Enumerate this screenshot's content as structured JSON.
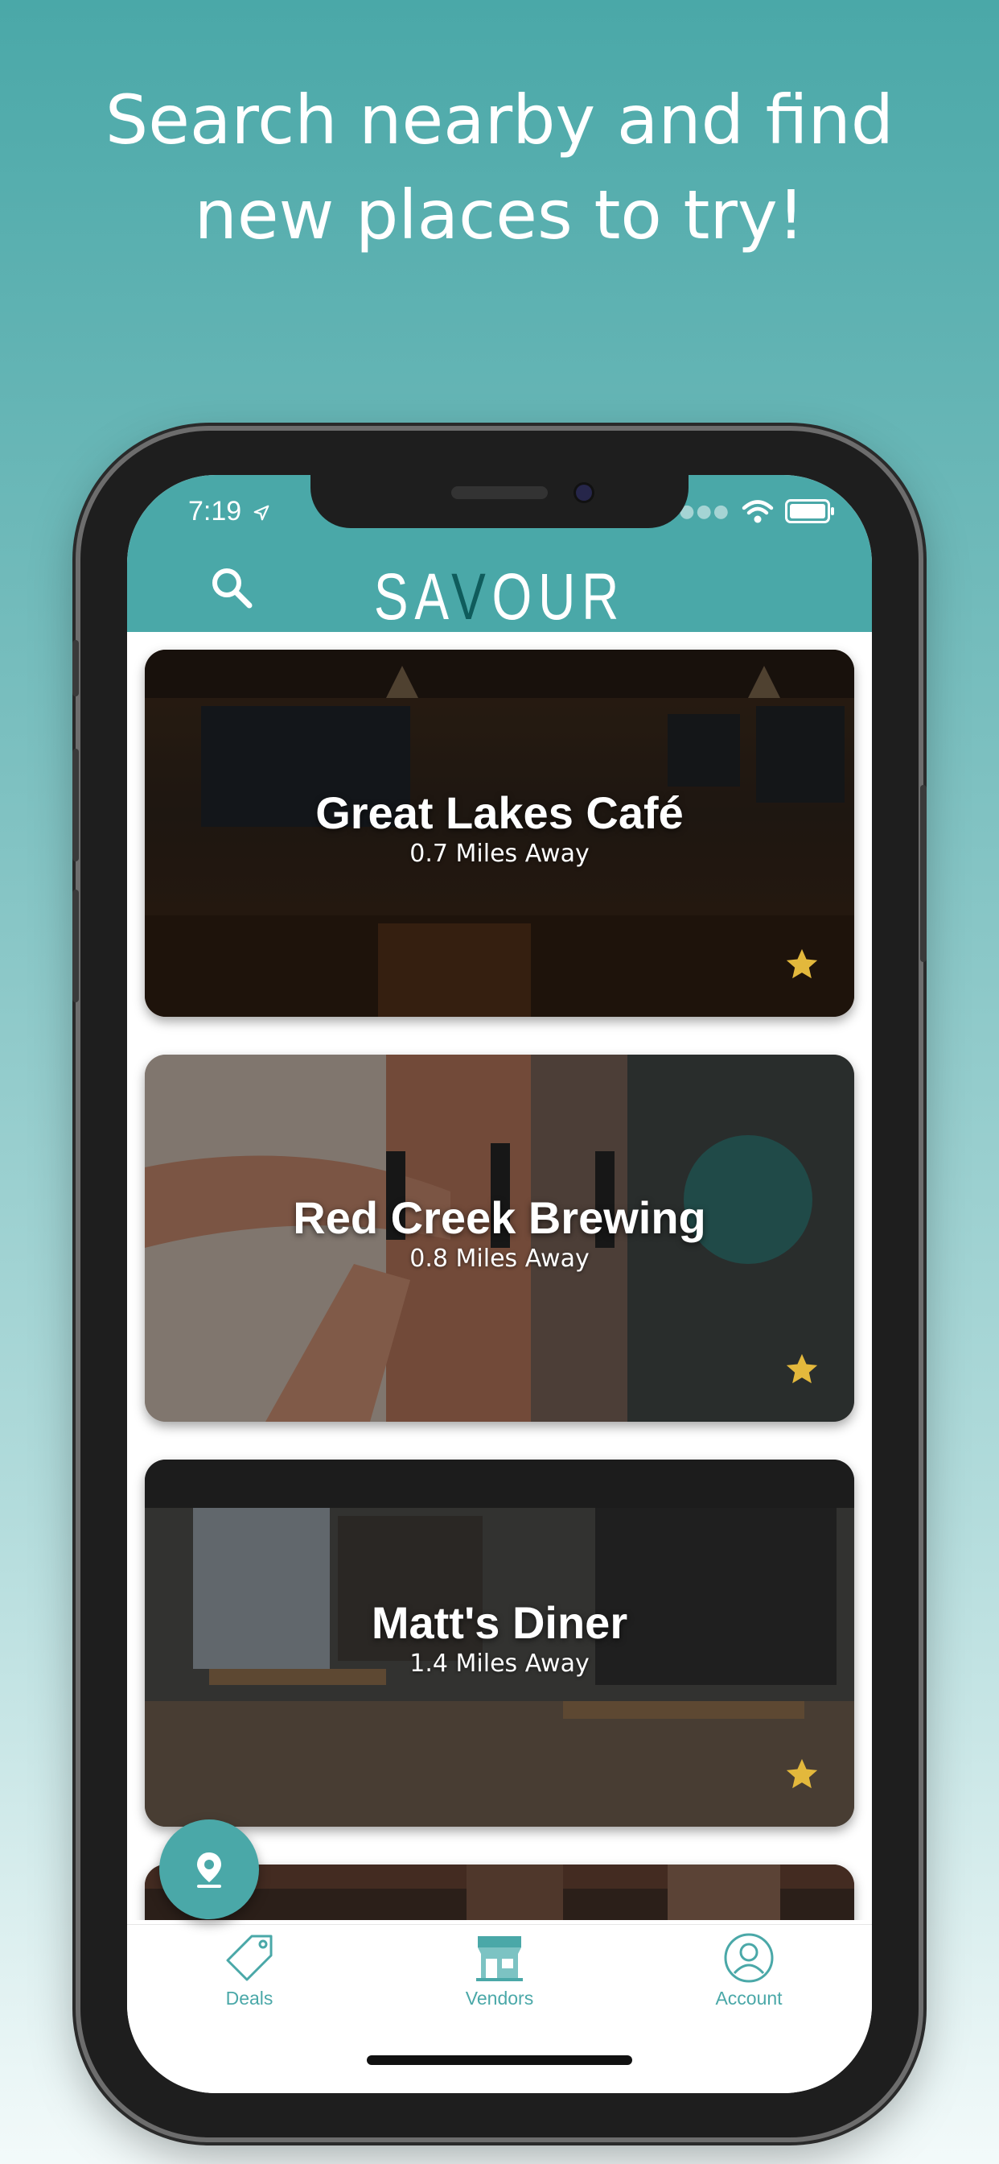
{
  "promo": {
    "line1": "Search nearby and find",
    "line2": "new places to try!"
  },
  "status_bar": {
    "time": "7:19"
  },
  "header": {
    "logo": "SAVOUR",
    "logo_letters": [
      "SA",
      "V",
      "OUR"
    ]
  },
  "vendors": [
    {
      "name": "Great Lakes Café",
      "distance": "0.7 Miles Away"
    },
    {
      "name": "Red Creek Brewing",
      "distance": "0.8 Miles Away"
    },
    {
      "name": "Matt's Diner",
      "distance": "1.4 Miles Away"
    }
  ],
  "tabs": [
    {
      "label": "Deals",
      "icon": "tag-icon"
    },
    {
      "label": "Vendors",
      "icon": "storefront-icon"
    },
    {
      "label": "Account",
      "icon": "person-icon"
    }
  ],
  "colors": {
    "brand": "#4aa8a8",
    "logo_accent": "#0f5c5c",
    "star": "#e3b83c"
  }
}
